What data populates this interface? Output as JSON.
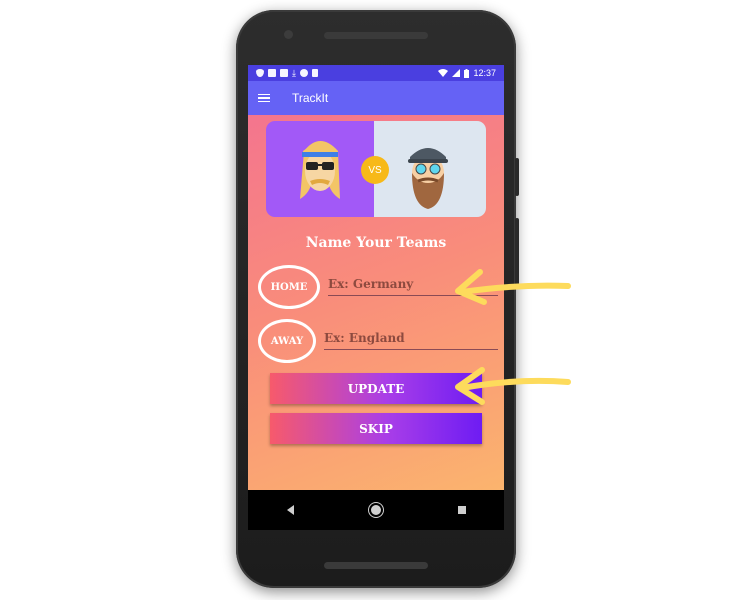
{
  "status_bar": {
    "time": "12:37",
    "left_icons": [
      "shield-icon",
      "image-icon",
      "app-icon",
      "download-icon",
      "sync-icon",
      "sim-icon"
    ],
    "right_icons": [
      "wifi-icon",
      "signal-icon",
      "battery-icon"
    ]
  },
  "app_bar": {
    "title": "TrackIt",
    "menu_icon": "hamburger-menu-icon"
  },
  "matchup": {
    "vs_label": "VS",
    "home_avatar": "hipster-sunglasses-avatar",
    "away_avatar": "bearded-cap-avatar"
  },
  "form": {
    "heading": "Name Your Teams",
    "home_label": "HOME",
    "home_placeholder": "Ex: Germany",
    "away_label": "AWAY",
    "away_placeholder": "Ex: England"
  },
  "buttons": {
    "update_label": "UPDATE",
    "skip_label": "SKIP"
  },
  "colors": {
    "status_bar": "#4a3fe0",
    "app_bar": "#6562f5",
    "background_top": "#f4758e",
    "background_bottom": "#fbb46e",
    "button_start": "#f75a6b",
    "button_end": "#6e1cf3",
    "vs_badge": "#f7b918",
    "annotation_arrow": "#fddb5c"
  },
  "nav_bar": {
    "icons": [
      "back-icon",
      "home-icon",
      "recents-icon"
    ]
  }
}
